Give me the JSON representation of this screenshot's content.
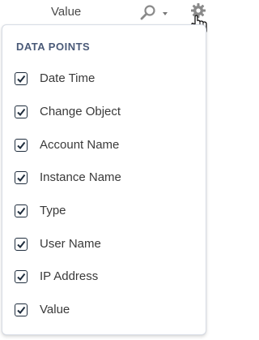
{
  "header": {
    "column_label": "Value",
    "search_icon": "search-icon",
    "caret_icon": "caret-down-icon",
    "settings_icon": "gear-icon",
    "cursor_icon": "hand-pointer-icon"
  },
  "panel": {
    "title": "DATA POINTS",
    "items": [
      {
        "label": "Date Time",
        "checked": true
      },
      {
        "label": "Change Object",
        "checked": true
      },
      {
        "label": "Account Name",
        "checked": true
      },
      {
        "label": "Instance Name",
        "checked": true
      },
      {
        "label": "Type",
        "checked": true
      },
      {
        "label": "User Name",
        "checked": true
      },
      {
        "label": "IP Address",
        "checked": true
      },
      {
        "label": "Value",
        "checked": true
      }
    ]
  },
  "colors": {
    "title": "#4a5a78",
    "text": "#3a3a3a",
    "checkbox_border": "#1f2d3d",
    "icon": "#8a8a8a"
  }
}
